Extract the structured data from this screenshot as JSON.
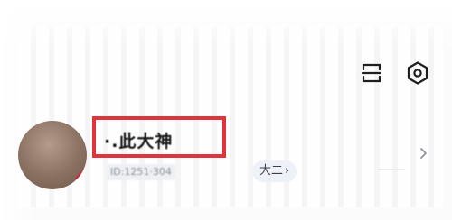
{
  "header": {
    "icons": [
      "scan-icon",
      "settings-icon"
    ]
  },
  "profile": {
    "nickname": "·.此大神",
    "user_id": "ID:1251·304",
    "grade": "大二",
    "grade_chevron": "›",
    "row_chevron": "›"
  },
  "colors": {
    "highlight": "#e0333c",
    "tag_background": "#eef1f7"
  }
}
